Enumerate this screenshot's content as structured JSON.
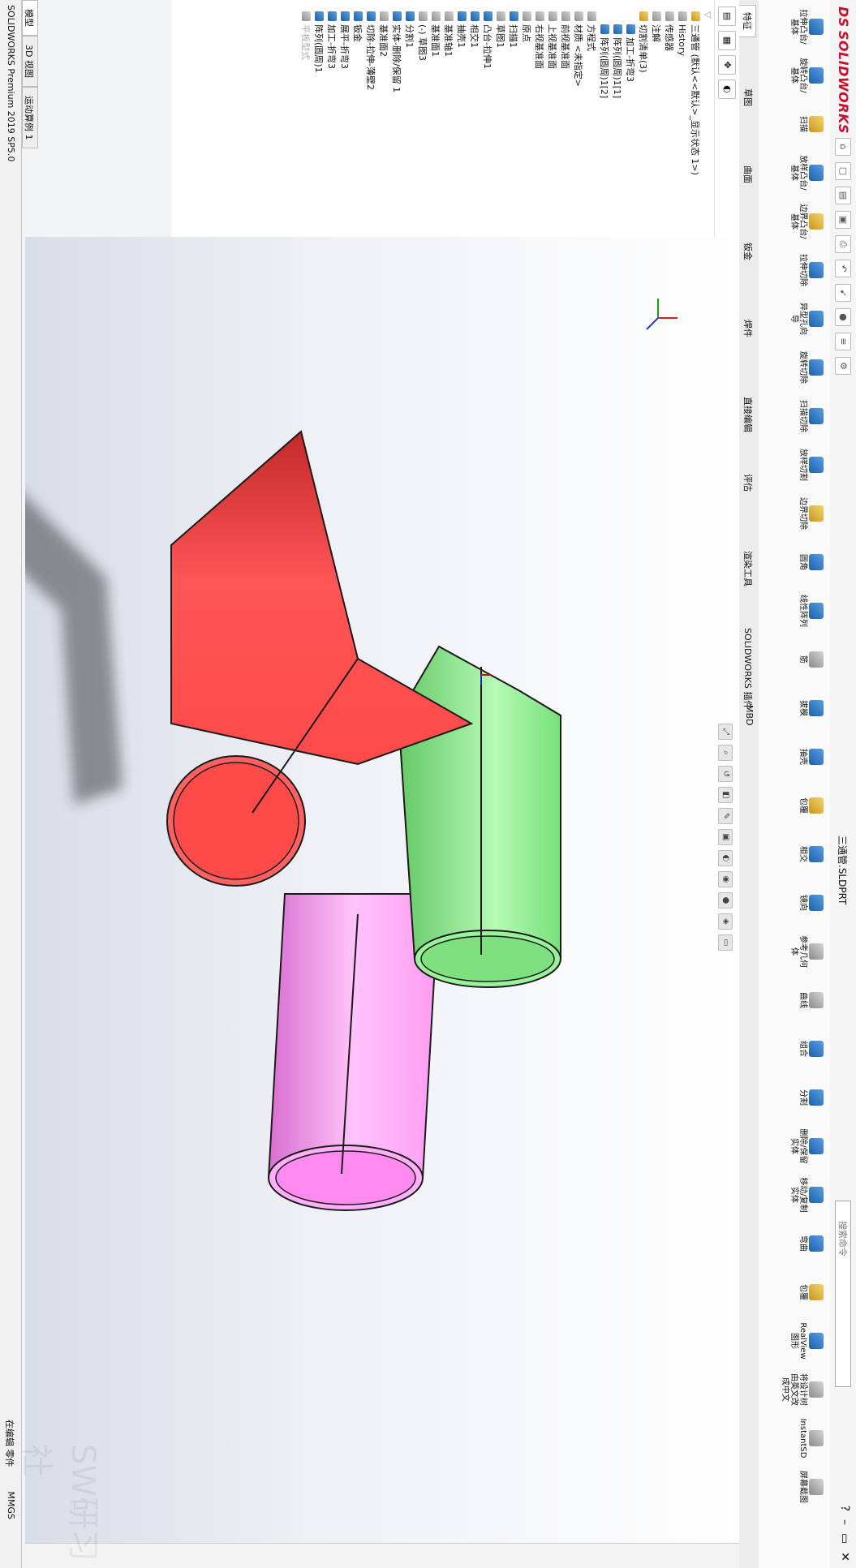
{
  "app": {
    "logo_text": "SOLIDWORKS",
    "document_title": "三通管.SLDPRT",
    "search_placeholder": "搜索命令",
    "version": "SOLIDWORKS Premium 2019 SP5.0"
  },
  "ribbon": {
    "features": [
      "拉伸凸台/基体",
      "旋转凸台/基体",
      "扫描",
      "放样凸台/基体",
      "边界凸台/基体",
      "拉伸切除",
      "异型孔向导",
      "旋转切除",
      "扫描切除",
      "放样切割",
      "边界切除",
      "圆角",
      "线性阵列",
      "筋",
      "拔模",
      "抽壳",
      "包覆",
      "相交",
      "镜向",
      "参考几何体",
      "曲线",
      "组合",
      "分割",
      "删除/保留实体",
      "移动/复制实体",
      "弯曲",
      "包覆",
      "RealView图形",
      "将设计树由英文改成中文",
      "InstantSD",
      "屏幕截图"
    ]
  },
  "tabs": [
    "特征",
    "草图",
    "曲面",
    "钣金",
    "焊件",
    "直接编辑",
    "评估",
    "渲染工具",
    "SOLIDWORKS 插件",
    "MBD"
  ],
  "tree": {
    "root": "三通管 (默认<<默认>_显示状态 1>)",
    "items": [
      {
        "label": "History"
      },
      {
        "label": "传感器"
      },
      {
        "label": "注解"
      },
      {
        "label": "切割清单(3)"
      },
      {
        "label": "加工-折弯3",
        "indent": true
      },
      {
        "label": "阵列(圆周)1[1]",
        "indent": true
      },
      {
        "label": "阵列(圆周)1[2]",
        "indent": true
      },
      {
        "label": "方程式"
      },
      {
        "label": "材质 <未指定>"
      },
      {
        "label": "前视基准面"
      },
      {
        "label": "上视基准面"
      },
      {
        "label": "右视基准面"
      },
      {
        "label": "原点"
      },
      {
        "label": "扫描1"
      },
      {
        "label": "草图1"
      },
      {
        "label": "凸台-拉伸1"
      },
      {
        "label": "相交1"
      },
      {
        "label": "抽壳1"
      },
      {
        "label": "基准轴1"
      },
      {
        "label": "基准面1"
      },
      {
        "label": "(-) 草图3"
      },
      {
        "label": "分割1"
      },
      {
        "label": "实体-删除/保留 1"
      },
      {
        "label": "基准面2"
      },
      {
        "label": "切除-拉伸-薄壁2"
      },
      {
        "label": "钣金"
      },
      {
        "label": "展平-折弯3"
      },
      {
        "label": "加工-折弯3"
      },
      {
        "label": "阵列(圆周)1"
      },
      {
        "label": "平板型式",
        "grey": true
      }
    ]
  },
  "bottom_tabs": [
    "模型",
    "3D 视图",
    "运动算例 1"
  ],
  "status": {
    "left": "SOLIDWORKS Premium 2019 SP5.0",
    "mode": "在编辑 零件",
    "units": "MMGS",
    "watermark": "SW研习社"
  },
  "model": {
    "colors": {
      "red": "#ff4a4a",
      "green": "#8ef08e",
      "pink": "#ff9bf4",
      "edge": "#1b1b1b"
    }
  }
}
